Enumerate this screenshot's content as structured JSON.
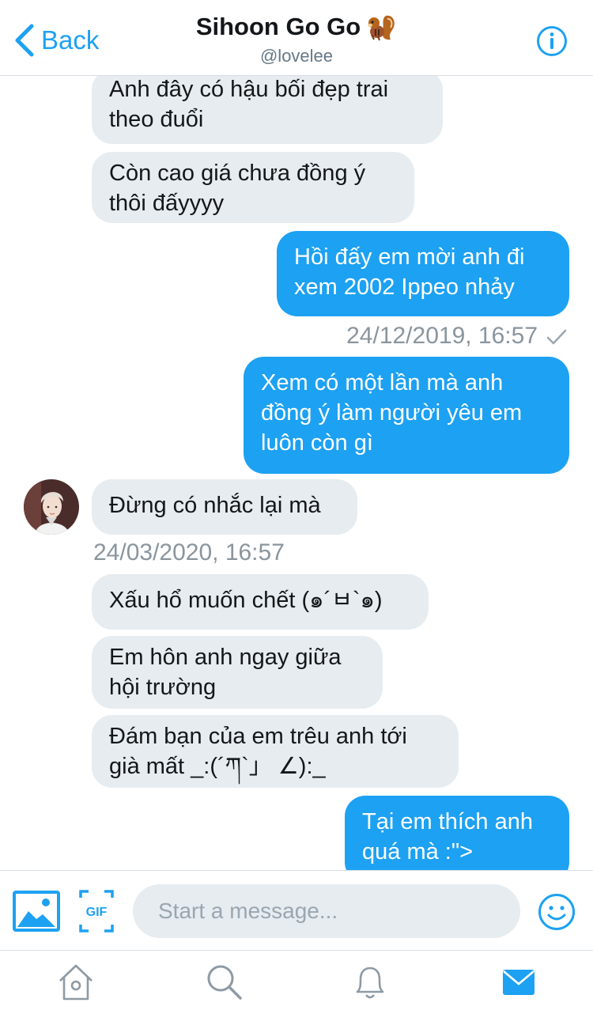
{
  "header": {
    "back_label": "Back",
    "title": "Sihoon Go Go",
    "handle": "@lovelee"
  },
  "messages": [
    {
      "side": "received",
      "text": "Anh đây có hậu bối đẹp trai\ntheo đuổi"
    },
    {
      "side": "received",
      "text": "Còn cao giá chưa đồng ý\nthôi đấyyyy"
    },
    {
      "side": "sent",
      "text": "Hồi đấy em mời anh đi\nxem 2002 Ippeo nhảy"
    },
    {
      "side": "sent_timestamp",
      "text": "24/12/2019, 16:57"
    },
    {
      "side": "sent",
      "text": "Xem có một lần mà anh\nđồng ý làm người yêu em\nluôn còn gì"
    },
    {
      "side": "received",
      "text": "Đừng có nhắc lại mà"
    },
    {
      "side": "received_timestamp",
      "text": "24/03/2020, 16:57"
    },
    {
      "side": "received",
      "text": "Xấu hổ muốn chết (๑´ㅂ`๑)"
    },
    {
      "side": "received",
      "text": "Em hôn anh ngay giữa\nhội trường"
    },
    {
      "side": "received",
      "text": "Đám bạn của em trêu anh tới\ngià mất _:(´ཀ`」 ∠):_"
    },
    {
      "side": "sent",
      "text": "Tại em thích anh\nquá mà :\">"
    }
  ],
  "composer": {
    "placeholder": "Start a message...",
    "gif_label": "GIF"
  },
  "tabs": [
    {
      "icon": "home-icon"
    },
    {
      "icon": "search-icon"
    },
    {
      "icon": "bell-icon"
    },
    {
      "icon": "mail-icon",
      "active": true
    }
  ],
  "colors": {
    "accent": "#1da1f2",
    "received_bubble": "#e6ecf0",
    "timestamp": "#8a959e",
    "inactive_icon": "#8e9aa4"
  }
}
